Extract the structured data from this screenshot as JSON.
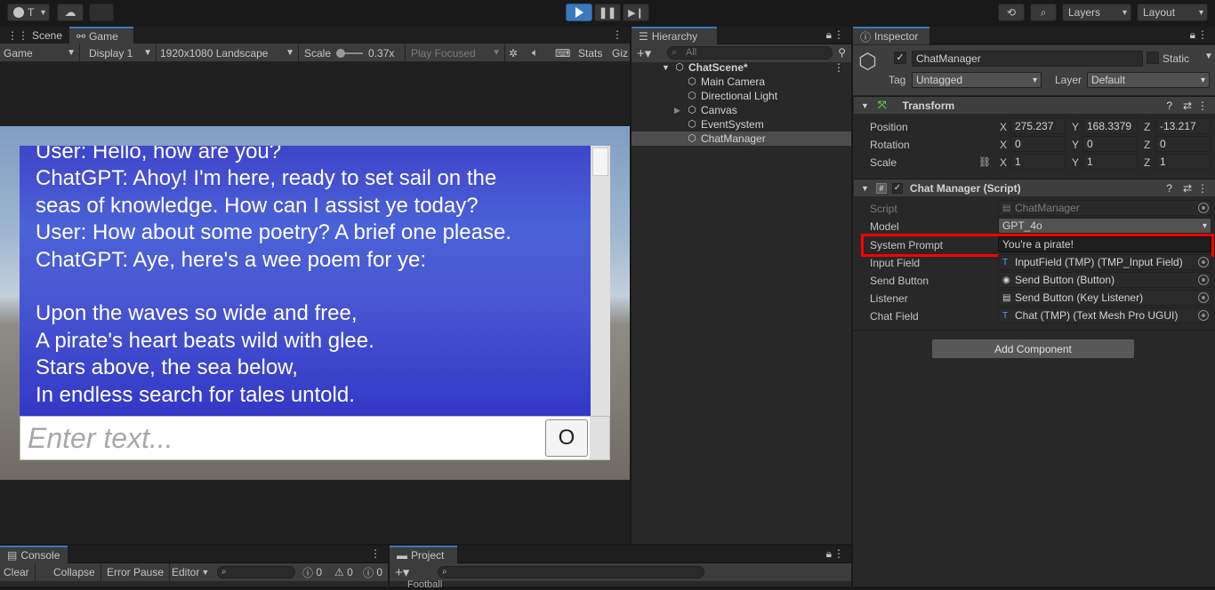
{
  "topbar": {
    "account_label": "T",
    "layers_label": "Layers",
    "layout_label": "Layout"
  },
  "game_panel": {
    "tab_scene": "Scene",
    "tab_game": "Game",
    "view_mode": "Game",
    "display": "Display 1",
    "resolution": "1920x1080 Landscape",
    "scale_label": "Scale",
    "scale_value": "0.37x",
    "play_mode": "Play Focused",
    "stats": "Stats",
    "gizmos": "Giz",
    "chat_lines": [
      "User: Hello, how are you?",
      "ChatGPT: Ahoy! I'm here, ready to set sail on the",
      "seas of knowledge. How can I assist ye today?",
      "User: How about some poetry? A brief one please.",
      "ChatGPT: Aye, here's a wee poem for ye:",
      "",
      "Upon the waves so wide and free,",
      "A pirate's heart beats wild with glee.",
      "Stars above, the sea below,",
      "In endless search for tales untold."
    ],
    "input_placeholder": "Enter text...",
    "send_button": "O"
  },
  "hierarchy": {
    "title": "Hierarchy",
    "search_placeholder": "All",
    "scene": "ChatScene*",
    "items": [
      "Main Camera",
      "Directional Light",
      "Canvas",
      "EventSystem",
      "ChatManager"
    ]
  },
  "inspector": {
    "title": "Inspector",
    "object_name": "ChatManager",
    "static_label": "Static",
    "tag_label": "Tag",
    "tag_value": "Untagged",
    "layer_label": "Layer",
    "layer_value": "Default",
    "transform": {
      "title": "Transform",
      "position_label": "Position",
      "rotation_label": "Rotation",
      "scale_label": "Scale",
      "position": [
        "275.237",
        "168.3379",
        "-13.217"
      ],
      "rotation": [
        "0",
        "0",
        "0"
      ],
      "scale": [
        "1",
        "1",
        "1"
      ],
      "axis": [
        "X",
        "Y",
        "Z"
      ]
    },
    "chat_manager": {
      "title": "Chat Manager (Script)",
      "script_label": "Script",
      "script_value": "ChatManager",
      "model_label": "Model",
      "model_value": "GPT_4o",
      "prompt_label": "System Prompt",
      "prompt_value": "You're a pirate!",
      "input_label": "Input Field",
      "input_value": "InputField (TMP) (TMP_Input Field)",
      "send_label": "Send Button",
      "send_value": "Send Button (Button)",
      "listener_label": "Listener",
      "listener_value": "Send Button (Key Listener)",
      "chat_label": "Chat Field",
      "chat_value": "Chat (TMP) (Text Mesh Pro UGUI)"
    },
    "add_component": "Add Component",
    "highlight_color": "#ff0000"
  },
  "console": {
    "title": "Console",
    "clear": "Clear",
    "collapse": "Collapse",
    "error_pause": "Error Pause",
    "editor": "Editor",
    "count_log": "0",
    "count_warn": "0",
    "count_err": "0"
  },
  "project": {
    "title": "Project",
    "partial_item": "Football"
  }
}
